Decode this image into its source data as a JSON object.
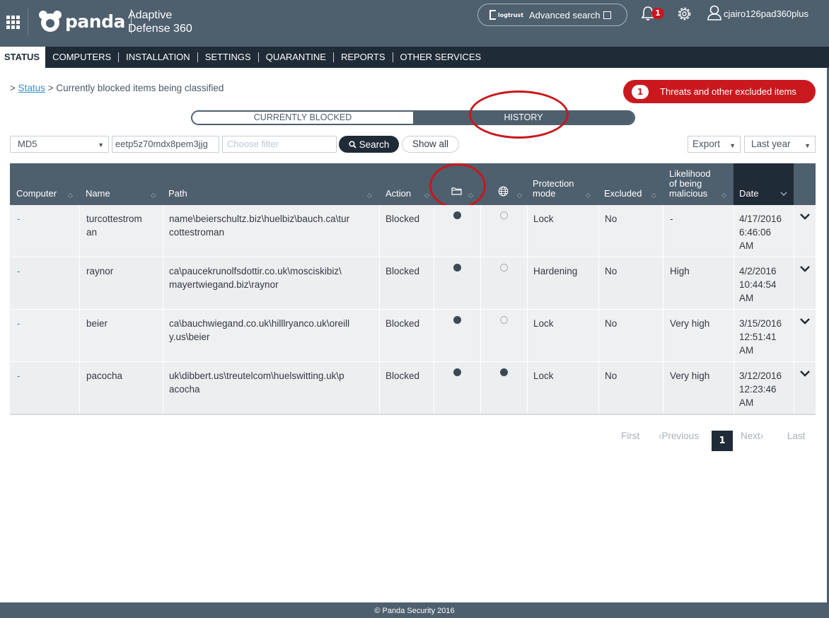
{
  "header": {
    "brand": "panda",
    "product_line1": "Adaptive",
    "product_line2": "Defense 360",
    "logtrust": "logtrust",
    "advanced_search": "Advanced search",
    "notification_count": "1",
    "username": "cjairo126pad360plus"
  },
  "nav": {
    "items": [
      "STATUS",
      "COMPUTERS",
      "INSTALLATION",
      "SETTINGS",
      "QUARANTINE",
      "REPORTS",
      "OTHER SERVICES"
    ],
    "active": "STATUS"
  },
  "breadcrumb": {
    "prefix": ">",
    "link": "Status",
    "current": "> Currently blocked items being classified"
  },
  "threats_button": {
    "count": "1",
    "label": "Threats and other excluded items",
    "color": "#c9191f"
  },
  "tabs": {
    "current": "CURRENTLY BLOCKED",
    "history": "HISTORY",
    "selected": "HISTORY"
  },
  "filters": {
    "field_select": "MD5",
    "hash_value": "eetp5z70mdx8pem3jjg",
    "filter_placeholder": "Choose filter",
    "search_label": "Search",
    "show_all_label": "Show all",
    "export_label": "Export",
    "period_label": "Last year"
  },
  "table": {
    "columns": [
      "Computer",
      "Name",
      "Path",
      "Action",
      "folder-icon",
      "globe-icon",
      "Protection mode",
      "Excluded",
      "Likelihood of being malicious",
      "Date"
    ],
    "headers": {
      "computer": "Computer",
      "name": "Name",
      "path": "Path",
      "action": "Action",
      "protection1": "Protection",
      "protection2": "mode",
      "excluded": "Excluded",
      "likelihood1": "Likelihood",
      "likelihood2": "of being",
      "likelihood3": "malicious",
      "date": "Date"
    },
    "rows": [
      {
        "computer": "-",
        "name1": "turcottestrom",
        "name2": "an",
        "path1": "name\\beierschultz.biz\\huelbiz\\bauch.ca\\tur",
        "path2": "cottestroman",
        "action": "Blocked",
        "folder": true,
        "globe": false,
        "mode": "Lock",
        "excluded": "No",
        "likelihood": "-",
        "date1": "4/17/2016",
        "date2": "6:46:06",
        "date3": "AM"
      },
      {
        "computer": "-",
        "name1": "raynor",
        "name2": "",
        "path1": "ca\\paucekrunolfsdottir.co.uk\\mosciskibiz\\",
        "path2": "mayertwiegand.biz\\raynor",
        "action": "Blocked",
        "folder": true,
        "globe": false,
        "mode": "Hardening",
        "excluded": "No",
        "likelihood": "High",
        "date1": "4/2/2016",
        "date2": "10:44:54",
        "date3": "AM"
      },
      {
        "computer": "-",
        "name1": "beier",
        "name2": "",
        "path1": "ca\\bauchwiegand.co.uk\\hilllryanco.uk\\oreill",
        "path2": "y.us\\beier",
        "action": "Blocked",
        "folder": true,
        "globe": false,
        "mode": "Lock",
        "excluded": "No",
        "likelihood": "Very high",
        "date1": "3/15/2016",
        "date2": "12:51:41",
        "date3": "AM"
      },
      {
        "computer": "-",
        "name1": "pacocha",
        "name2": "",
        "path1": "uk\\dibbert.us\\treutelcom\\huelswitting.uk\\p",
        "path2": "acocha",
        "action": "Blocked",
        "folder": true,
        "globe": true,
        "mode": "Lock",
        "excluded": "No",
        "likelihood": "Very high",
        "date1": "3/12/2016",
        "date2": "12:23:46",
        "date3": "AM"
      }
    ]
  },
  "pagination": {
    "first": "First",
    "previous": "Previous",
    "current": "1",
    "next": "Next",
    "last": "Last"
  },
  "footer": {
    "text": "© Panda Security 2016"
  },
  "colors": {
    "header_bg": "#4e5f6e",
    "nav_bg": "#1f2b36",
    "accent_red": "#c9191f",
    "link": "#3b8fc6"
  }
}
